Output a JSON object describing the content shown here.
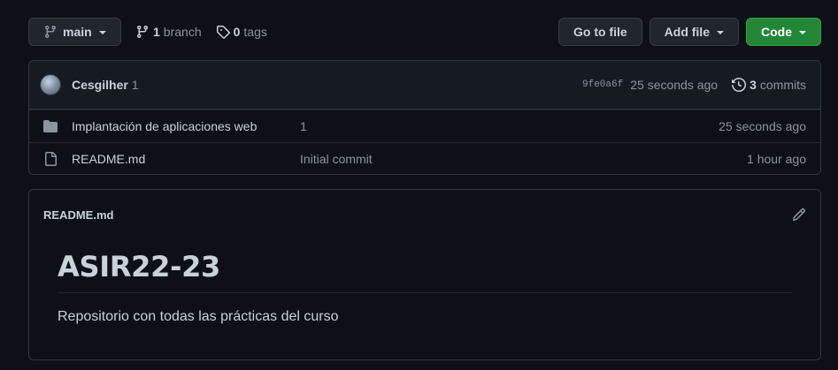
{
  "toolbar": {
    "branch_label": "main",
    "branches_count": "1",
    "branches_label": "branch",
    "tags_count": "0",
    "tags_label": "tags",
    "goto_file_label": "Go to file",
    "add_file_label": "Add file",
    "code_label": "Code"
  },
  "commit": {
    "author": "Cesgilher",
    "message": "1",
    "sha": "9fe0a6f",
    "time": "25 seconds ago",
    "commits_count": "3",
    "commits_label": "commits"
  },
  "files": [
    {
      "icon": "folder-icon",
      "name": "Implantación de aplicaciones web",
      "message": "1",
      "time": "25 seconds ago"
    },
    {
      "icon": "file-icon",
      "name": "README.md",
      "message": "Initial commit",
      "time": "1 hour ago"
    }
  ],
  "readme": {
    "filename": "README.md",
    "heading": "ASIR22-23",
    "paragraph": "Repositorio con todas las prácticas del curso"
  },
  "colors": {
    "background": "#0d1117",
    "border": "#30363d",
    "code_button": "#238636",
    "folder_icon": "#8b949e"
  }
}
